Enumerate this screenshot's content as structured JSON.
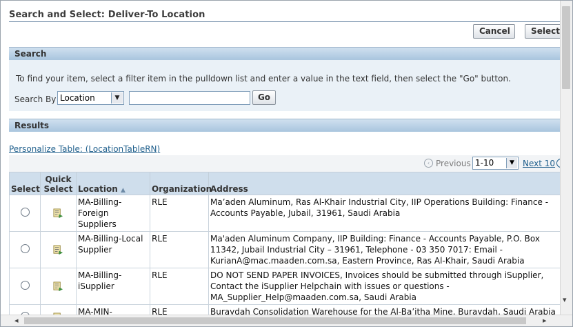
{
  "window": {
    "title": "Search and Select: Deliver-To Location"
  },
  "buttons": {
    "cancel": "Cancel",
    "select": "Select",
    "go": "Go"
  },
  "search": {
    "header": "Search",
    "instructions": "To find your item, select a filter item in the pulldown list and enter a value in the text field, then select the \"Go\" button.",
    "search_by_label": "Search By",
    "search_by_value": "Location",
    "input_value": ""
  },
  "results": {
    "header": "Results",
    "personalize_link": "Personalize Table: (LocationTableRN)",
    "previous": "Previous",
    "range": "1-10",
    "next": "Next 10",
    "columns": {
      "select": "Select",
      "quick_select_1": "Quick",
      "quick_select_2": "Select",
      "location": "Location",
      "organization": "Organization",
      "address": "Address"
    },
    "rows": [
      {
        "location": "MA-Billing-Foreign Suppliers",
        "organization": "RLE",
        "address": "Ma’aden Aluminum, Ras Al-Khair Industrial City, IIP Operations Building: Finance - Accounts Payable, Jubail, 31961, Saudi Arabia"
      },
      {
        "location": "MA-Billing-Local Supplier",
        "organization": "RLE",
        "address": "Ma'aden Aluminum Company, IIP Building: Finance - Accounts Payable, P.O. Box 11342, Jubail Industrial City – 31961, Telephone - 03 350 7017: Email - KurianA@mac.maaden.com.sa, Eastern Province, Ras Al-Khair, Saudi Arabia"
      },
      {
        "location": "MA-Billing-iSupplier",
        "organization": "RLE",
        "address": "DO NOT SEND PAPER INVOICES, Invoices should be submitted through iSupplier, Contact the iSupplier Helpchain with issues or questions - MA_Supplier_Help@maaden.com.sa, Saudi Arabia"
      },
      {
        "location": "MA-MIN-CONSOL-WH",
        "organization": "RLE",
        "address": "Buraydah Consolidation Warehouse for the Al-Ba’itha Mine, Buraydah, Saudi Arabia"
      }
    ]
  }
}
